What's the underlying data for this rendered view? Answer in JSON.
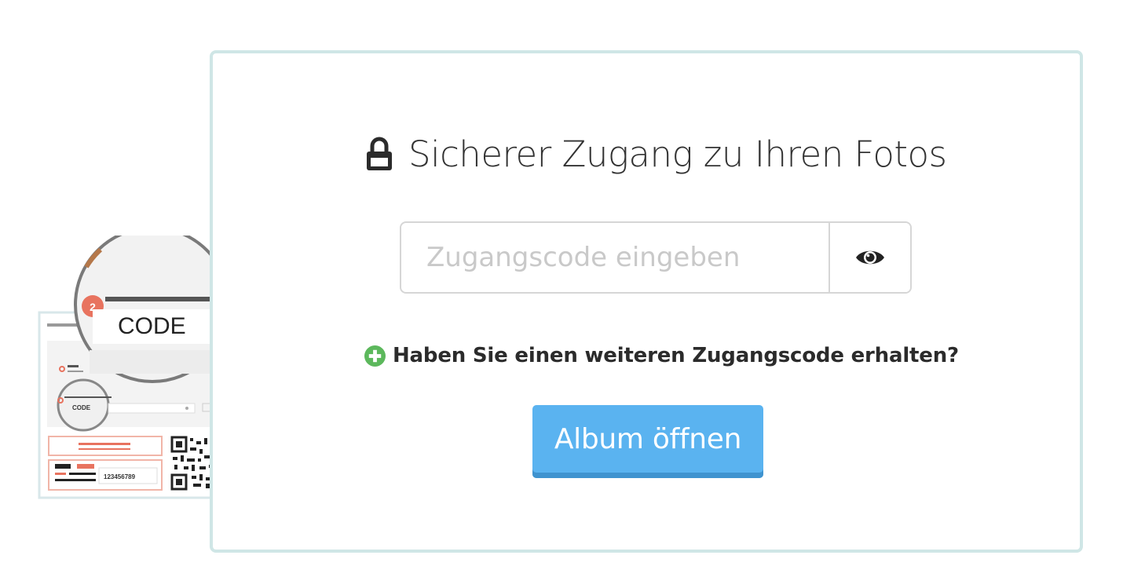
{
  "access": {
    "title": "Sicherer Zugang zu Ihren Fotos",
    "code_placeholder": "Zugangscode eingeben",
    "more_code_link": "Haben Sie einen weiteren Zugangscode erhalten?",
    "open_button": "Album öffnen"
  },
  "illustration": {
    "magnifier_label": "CODE",
    "small_label": "CODE",
    "step_number": "2",
    "ticket_number": "123456789"
  },
  "icons": {
    "title_icon": "lock-icon",
    "reveal_icon": "eye-icon",
    "add_icon": "plus-circle-icon"
  },
  "colors": {
    "card_border": "#cfe6e6",
    "button": "#5ab3f0",
    "plus_green": "#5cb85c",
    "accent_red": "#e8735f"
  }
}
